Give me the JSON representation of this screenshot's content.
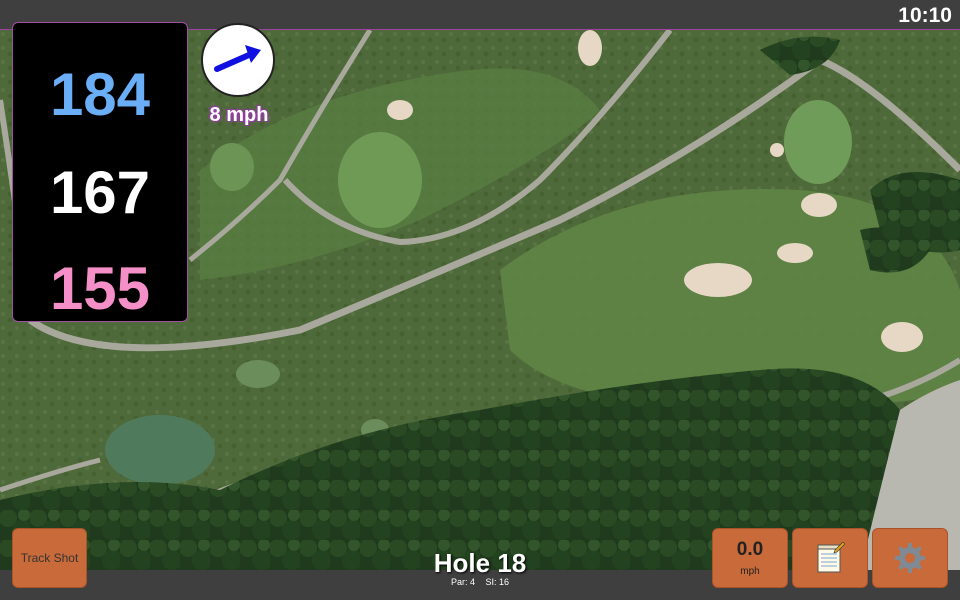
{
  "status": {
    "clock": "10:10"
  },
  "distances": {
    "back": "184",
    "center": "167",
    "front": "155"
  },
  "wind": {
    "speed_label": "8 mph"
  },
  "hole": {
    "title": "Hole 18",
    "par": "Par: 4",
    "si": "SI: 16"
  },
  "buttons": {
    "track_shot": "Track Shot",
    "speed_value": "0.0",
    "speed_unit": "mph",
    "notes_icon": "notepad-icon",
    "settings_icon": "gear-icon"
  },
  "colors": {
    "back": "#6aaef7",
    "center": "#ffffff",
    "front": "#f58fc8",
    "button": "#c86a3a",
    "bar": "#3f3f3f"
  }
}
